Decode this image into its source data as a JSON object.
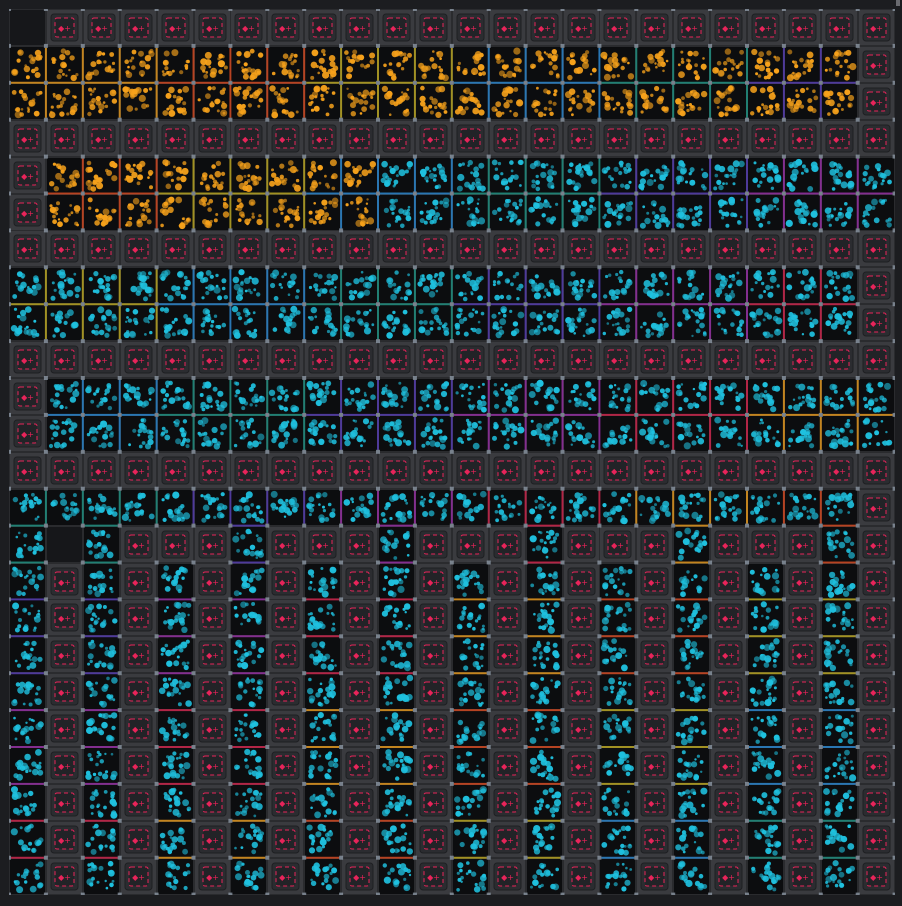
{
  "board": {
    "cols": 24,
    "rows": 24,
    "colors": {
      "background": "#1c1d20",
      "rack_tile": "#3a3b3f",
      "rack_glyph": "#e8245a",
      "storage_tile": "#0c0d0f",
      "ore_orange": "#f7a21b",
      "ore_cyan": "#1fc1df",
      "wire_joint": "#9aa6b5",
      "empty_tile": "#16171a"
    },
    "legend": {
      "R": "rack-tile",
      "O": "orange-storage-tile",
      "C": "cyan-storage-tile",
      "E": "empty-tile"
    },
    "map": [
      "ERRRRRRRRRRRRRRRRRRRRRRR",
      "OOOOOOOOOOOOOOOOOOOOOOOR",
      "OOOOOOOOOOOOOOOOOOOOOOOR",
      "RRRRRRRRRRRRRRRRRRRRRRRR",
      "ROOOOOOOOOCCCCCCCCCCCCCC",
      "ROOOOOOOOOCCCCCCCCCCCCCC",
      "RRRRRRRRRRRRRRRRRRRRRRRR",
      "CCCCCCCCCCCCCCCCCCCCCCCR",
      "CCCCCCCCCCCCCCCCCCCCCCCR",
      "RRRRRRRRRRRRRRRRRRRRRRRR",
      "RCCCCCCCCCCCCCCCCCCCCCCC",
      "RCCCCCCCCCCCCCCCCCCCCCCC",
      "RRRRRRRRRRRRRRRRRRRRRRRR",
      "CCCCCCCCCCCCCCCCCCCCCCCR",
      "CECRRRCRRRCRRRCRRRCRRRCR",
      "CRCRCRCRCRCRCRCRCRCRCRCR",
      "CRCRCRCRCRCRCRCRCRCRCRCR",
      "CRCRCRCRCRCRCRCRCRCRCRCR",
      "CRCRCRCRCRCRCRCRCRCRCRCR",
      "CRCRCRCRCRCRCRCRCRCRCRCR",
      "CRCRCRCRCRCRCRCRCRCRCRCR",
      "CRCRCRCRCRCRCRCRCRCRCRCR",
      "CRCRCRCRCRCRCRCRCRCRCRCR",
      "CRCRCRCRCRCRCRCRCRCRCRCR"
    ]
  }
}
